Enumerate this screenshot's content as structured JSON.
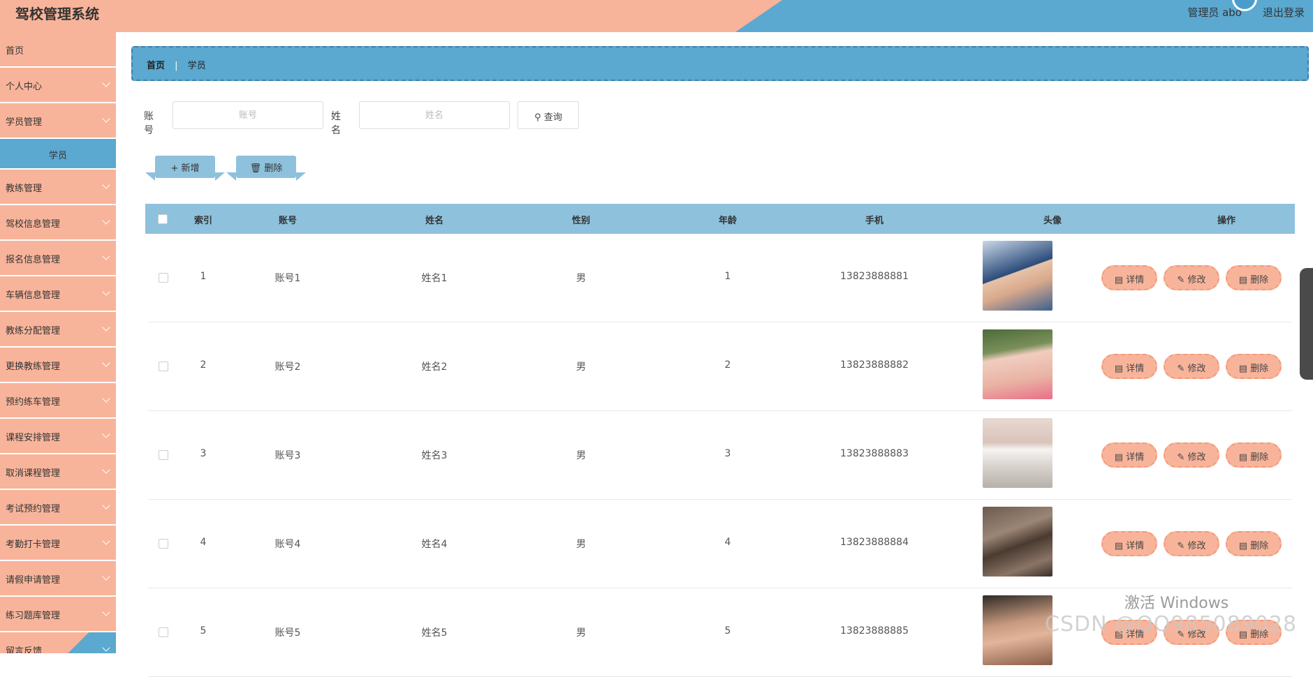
{
  "header": {
    "title": "驾校管理系统",
    "user": "管理员 abo",
    "logout": "退出登录"
  },
  "sidebar": {
    "items": [
      {
        "label": "首页"
      },
      {
        "label": "个人中心"
      },
      {
        "label": "学员管理"
      },
      {
        "label": "学员"
      },
      {
        "label": "教练管理"
      },
      {
        "label": "驾校信息管理"
      },
      {
        "label": "报名信息管理"
      },
      {
        "label": "车辆信息管理"
      },
      {
        "label": "教练分配管理"
      },
      {
        "label": "更换教练管理"
      },
      {
        "label": "预约练车管理"
      },
      {
        "label": "课程安排管理"
      },
      {
        "label": "取消课程管理"
      },
      {
        "label": "考试预约管理"
      },
      {
        "label": "考勤打卡管理"
      },
      {
        "label": "请假申请管理"
      },
      {
        "label": "练习题库管理"
      },
      {
        "label": "留言反馈"
      }
    ]
  },
  "breadcrumb": {
    "home": "首页",
    "current": "学员"
  },
  "search": {
    "account_label": "账号",
    "account_placeholder": "账号",
    "name_label": "姓名",
    "name_placeholder": "姓名",
    "query_label": "查询"
  },
  "actions": {
    "add_label": "新增",
    "delete_label": "删除"
  },
  "table": {
    "headers": [
      "索引",
      "账号",
      "姓名",
      "性别",
      "年龄",
      "手机",
      "头像",
      "操作"
    ],
    "rows": [
      {
        "index": "1",
        "account": "账号1",
        "name": "姓名1",
        "gender": "男",
        "age": "1",
        "phone": "13823888881"
      },
      {
        "index": "2",
        "account": "账号2",
        "name": "姓名2",
        "gender": "男",
        "age": "2",
        "phone": "13823888882"
      },
      {
        "index": "3",
        "account": "账号3",
        "name": "姓名3",
        "gender": "男",
        "age": "3",
        "phone": "13823888883"
      },
      {
        "index": "4",
        "account": "账号4",
        "name": "姓名4",
        "gender": "男",
        "age": "4",
        "phone": "13823888884"
      },
      {
        "index": "5",
        "account": "账号5",
        "name": "姓名5",
        "gender": "男",
        "age": "5",
        "phone": "13823888885"
      }
    ],
    "row_buttons": {
      "detail": "详情",
      "edit": "修改",
      "delete": "删除"
    }
  },
  "watermark": {
    "windows": "激活 Windows",
    "csdn": "CSDN @QQ985089028"
  },
  "colors": {
    "peach": "#f8b49a",
    "blue": "#5ba8d0",
    "table_header": "#8ec1dc"
  }
}
